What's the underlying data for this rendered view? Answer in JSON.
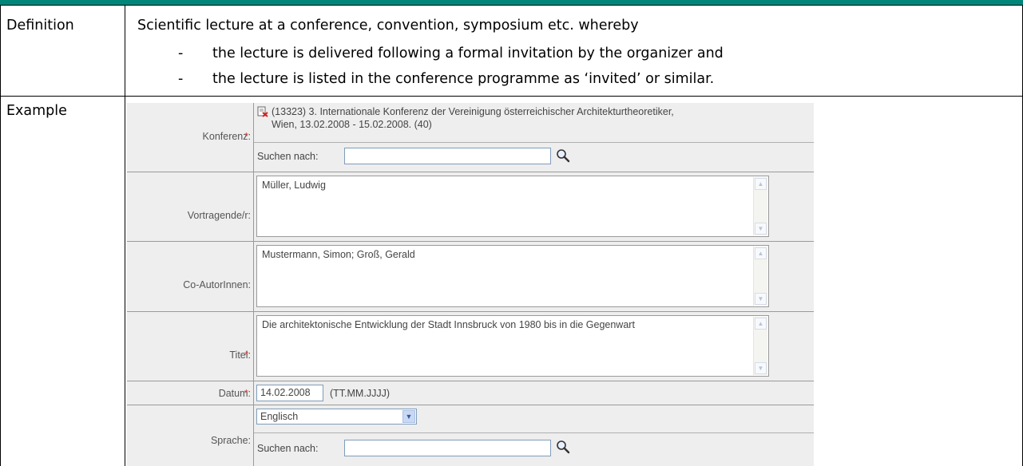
{
  "definition": {
    "label": "Definition",
    "intro": "Scientific lecture at a conference, convention, symposium etc. whereby",
    "bullets": [
      {
        "dash": "-",
        "text": "the lecture is delivered following a formal invitation by the organizer and"
      },
      {
        "dash": "-",
        "text": "the lecture is listed in the conference programme as ‘invited’ or similar."
      }
    ]
  },
  "example": {
    "label": "Example"
  },
  "form": {
    "required_mark": "*",
    "konferenz": {
      "label": "Konferenz:",
      "value_line1": "(13323) 3. Internationale Konferenz der Vereinigung österreichischer Architekturtheoretiker,",
      "value_line2": "Wien, 13.02.2008 - 15.02.2008. (40)",
      "search_label": "Suchen nach:",
      "search_value": ""
    },
    "vortragende": {
      "label": "Vortragende/r:",
      "value": "Müller, Ludwig"
    },
    "coautoren": {
      "label": "Co-AutorInnen:",
      "value": "Mustermann, Simon; Groß, Gerald"
    },
    "titel": {
      "label": "Titel:",
      "value": "Die architektonische Entwicklung der Stadt Innsbruck von 1980 bis in die Gegenwart"
    },
    "datum": {
      "label": "Datum:",
      "value": "14.02.2008",
      "format_hint": "(TT.MM.JJJJ)"
    },
    "sprache": {
      "label": "Sprache:",
      "selected": "Englisch",
      "search_label": "Suchen nach:",
      "search_value": ""
    }
  },
  "colors": {
    "banner": "#00857a",
    "required": "#d04040",
    "form_bg": "#eeeeee"
  }
}
